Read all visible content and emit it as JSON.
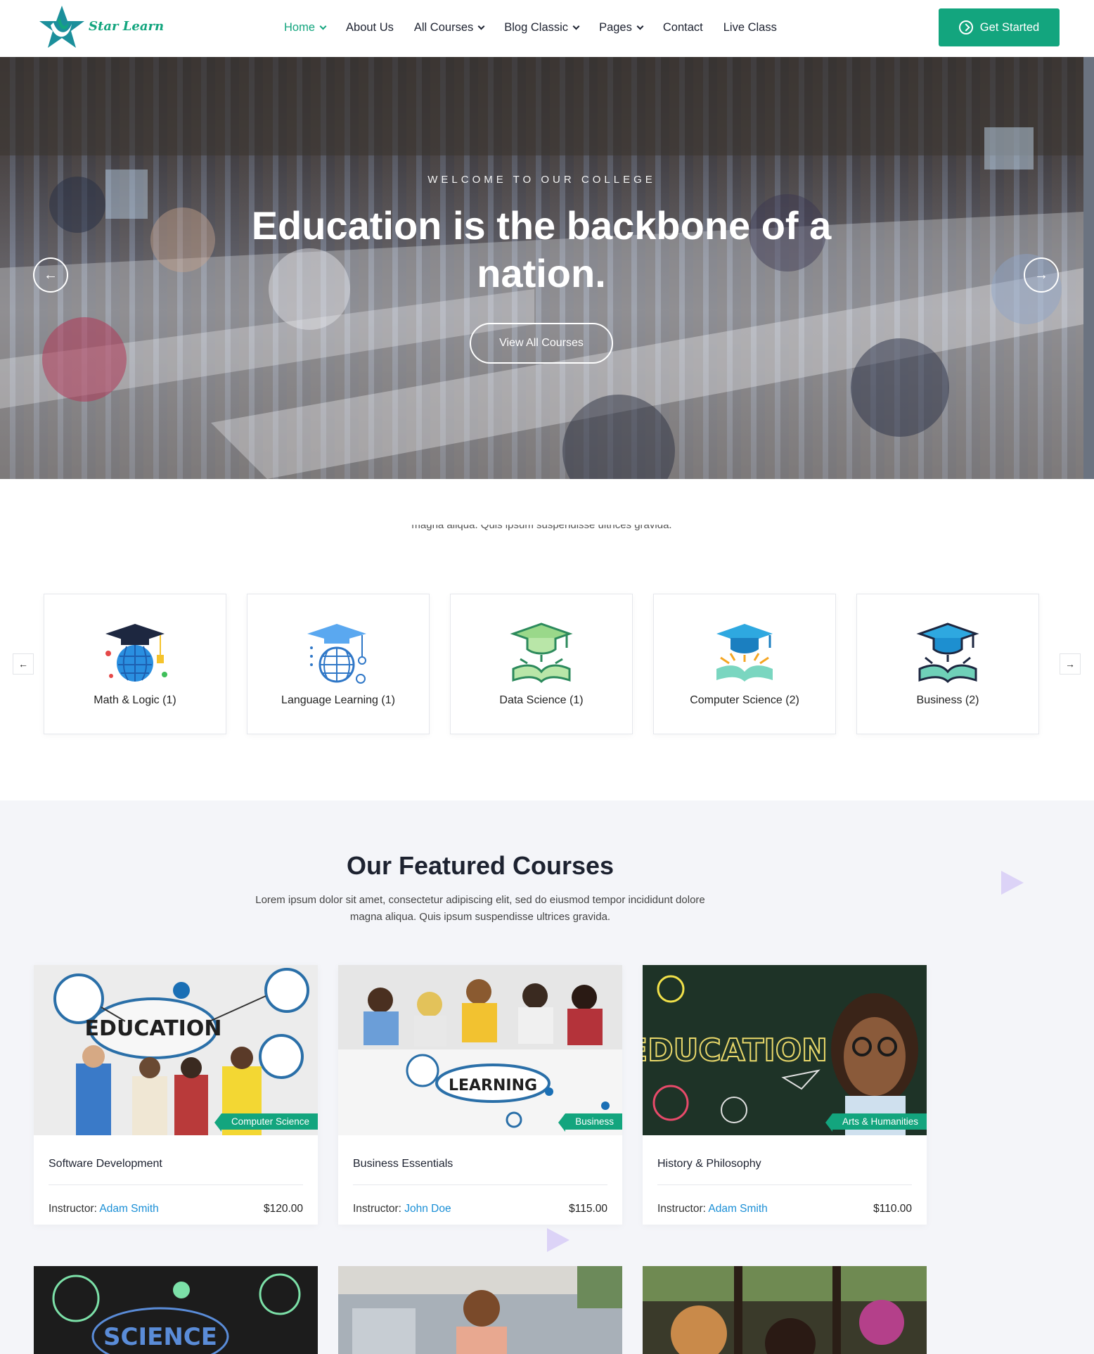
{
  "header": {
    "logo_text": "Star Learn",
    "nav": [
      {
        "label": "Home",
        "dropdown": true,
        "active": true
      },
      {
        "label": "About Us",
        "dropdown": false,
        "active": false
      },
      {
        "label": "All Courses",
        "dropdown": true,
        "active": false
      },
      {
        "label": "Blog Classic",
        "dropdown": true,
        "active": false
      },
      {
        "label": "Pages",
        "dropdown": true,
        "active": false
      },
      {
        "label": "Contact",
        "dropdown": false,
        "active": false
      },
      {
        "label": "Live Class",
        "dropdown": false,
        "active": false
      }
    ],
    "cta_label": "Get Started"
  },
  "hero": {
    "kicker": "WELCOME TO OUR COLLEGE",
    "title": "Education is the backbone of a nation.",
    "button_label": "View All Courses",
    "prev_icon": "arrow-left-icon",
    "next_icon": "arrow-right-icon"
  },
  "categories": {
    "cut_text": "magna aliqua. Quis ipsum suspendisse ultrices gravida.",
    "items": [
      {
        "label": "Math & Logic (1)",
        "icon": "graduation-globe-icon"
      },
      {
        "label": "Language Learning (1)",
        "icon": "graduation-world-icon"
      },
      {
        "label": "Data Science (1)",
        "icon": "graduation-book-icon"
      },
      {
        "label": "Computer Science (2)",
        "icon": "graduation-book-icon"
      },
      {
        "label": "Business (2)",
        "icon": "graduation-book-icon"
      }
    ]
  },
  "featured": {
    "title": "Our Featured Courses",
    "subtitle": "Lorem ipsum dolor sit amet, consectetur adipiscing elit, sed do eiusmod tempor incididunt dolore magna aliqua. Quis ipsum suspendisse ultrices gravida.",
    "instructor_prefix": "Instructor:",
    "courses": [
      {
        "title": "Software Development",
        "tag": "Computer Science",
        "instructor": "Adam Smith",
        "price": "$120.00",
        "image_word": "EDUCATION"
      },
      {
        "title": "Business Essentials",
        "tag": "Business",
        "instructor": "John Doe",
        "price": "$115.00",
        "image_word": "LEARNING"
      },
      {
        "title": "History & Philosophy",
        "tag": "Arts & Humanities",
        "instructor": "Adam Smith",
        "price": "$110.00",
        "image_word": "EDUCATION"
      }
    ],
    "second_row_word": "SCIENCE"
  },
  "colors": {
    "brand": "#13a57e",
    "link": "#1a8fd6",
    "section_bg": "#f4f5f9"
  }
}
